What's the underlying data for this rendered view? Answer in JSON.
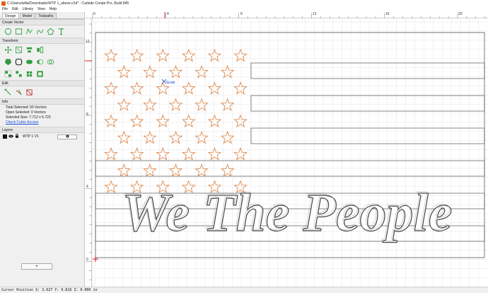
{
  "window": {
    "title": "C:/Users/willa/Downloads/WTP 1_above.c2d* - Carbide Create Pro, Build 845"
  },
  "menu": [
    "File",
    "Edit",
    "Library",
    "View",
    "Help"
  ],
  "tabs": [
    "Design",
    "Model",
    "Toolpaths"
  ],
  "sections": {
    "create_vector": "Create Vector",
    "transform": "Transform",
    "edit": "Edit",
    "info": "Info",
    "layers": "Layers"
  },
  "info": {
    "total_selected": "Total Selected:  50 Vectors",
    "open_selected": "Open Selected:  0 Vectors",
    "selected_size": "Selected Size:      7.712 x 5.723",
    "check_cutter": "Check Cutter Access"
  },
  "layer": {
    "name": "WTP 1 V1"
  },
  "add_layer_label": "+",
  "ruler": {
    "top_labels": [
      "0",
      "4",
      "8",
      "12",
      "16",
      "20"
    ],
    "left_labels": [
      "12",
      "8",
      "4",
      "0"
    ]
  },
  "canvas": {
    "handle_label": "Scale",
    "text_art": "We The People",
    "star_color": "#e08a4e",
    "line_color": "#555555"
  },
  "status": {
    "cursor": "Cursor Position X: 3.027 Y: 9.816 Z: 0.000 in"
  }
}
